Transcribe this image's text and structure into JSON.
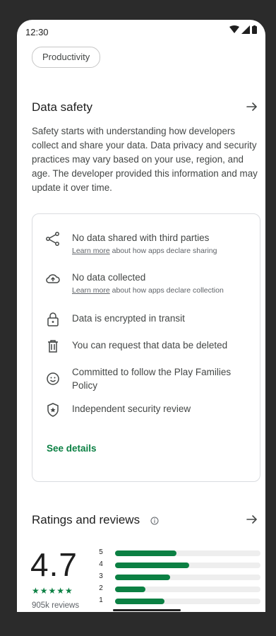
{
  "status_bar": {
    "time": "12:30"
  },
  "category_chip": "Productivity",
  "data_safety": {
    "title": "Data safety",
    "description": "Safety starts with understanding how developers collect and share your data. Data privacy and security practices may vary based on your use, region, and age. The developer provided this information and may update it over time.",
    "items": [
      {
        "icon": "share-icon",
        "text": "No data shared with third parties",
        "link": "Learn more",
        "sub": " about how apps declare sharing"
      },
      {
        "icon": "cloud-upload-icon",
        "text": "No data collected",
        "link": "Learn more",
        "sub": " about how apps declare collection"
      },
      {
        "icon": "lock-icon",
        "text": "Data is encrypted in transit"
      },
      {
        "icon": "trash-icon",
        "text": "You can request that data be deleted"
      },
      {
        "icon": "families-icon",
        "text": "Committed to follow the Play Families Policy"
      },
      {
        "icon": "shield-star-icon",
        "text": "Independent security review"
      }
    ],
    "see_details": "See details"
  },
  "ratings": {
    "title": "Ratings and reviews",
    "info_icon": "info-icon",
    "average": "4.7",
    "stars": "★★★★★",
    "reviews": "905k reviews",
    "bars": [
      {
        "label": "5",
        "fraction": 0.42
      },
      {
        "label": "4",
        "fraction": 0.51
      },
      {
        "label": "3",
        "fraction": 0.38
      },
      {
        "label": "2",
        "fraction": 0.21
      },
      {
        "label": "1",
        "fraction": 0.34
      }
    ],
    "accent": "#0b8043"
  }
}
